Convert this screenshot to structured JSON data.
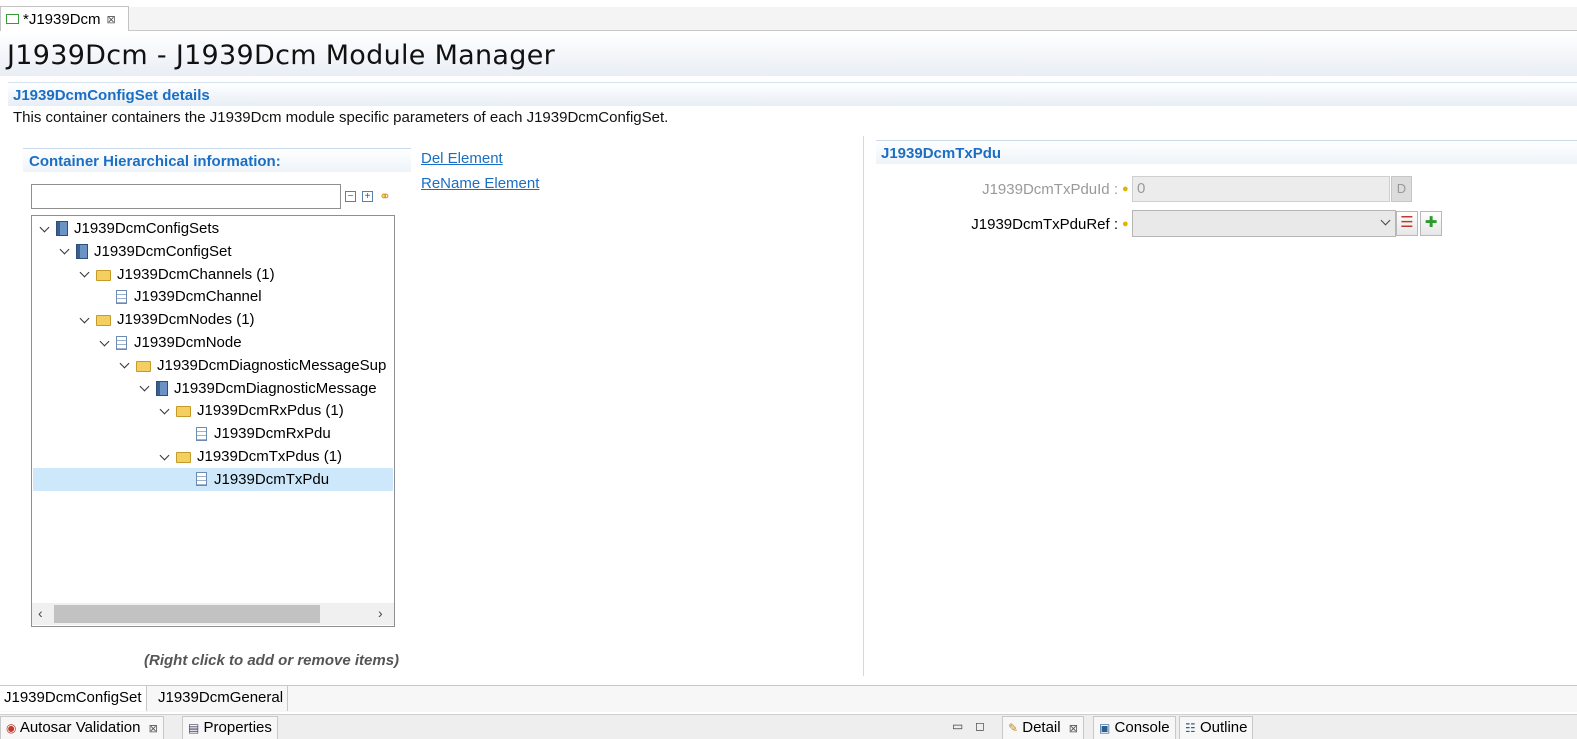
{
  "editor_tab": {
    "label": "*J1939Dcm",
    "close": "⊠"
  },
  "title": "J1939Dcm - J1939Dcm Module Manager",
  "section": {
    "title": "J1939DcmConfigSet details",
    "description": "This container containers the J1939Dcm module specific parameters of each J1939DcmConfigSet."
  },
  "hierarchy": {
    "title": "Container Hierarchical information:",
    "filter_value": "",
    "collapse_all": "−",
    "expand_all": "+",
    "link_icon": "⚭",
    "tree": [
      {
        "label": "J1939DcmConfigSets",
        "level": 0,
        "icon": "book-icon",
        "expanded": true
      },
      {
        "label": "J1939DcmConfigSet",
        "level": 1,
        "icon": "book-icon",
        "expanded": true
      },
      {
        "label": "J1939DcmChannels (1)",
        "level": 2,
        "icon": "folder-icon",
        "expanded": true
      },
      {
        "label": "J1939DcmChannel",
        "level": 3,
        "icon": "document-icon",
        "expanded": null
      },
      {
        "label": "J1939DcmNodes (1)",
        "level": 2,
        "icon": "folder-icon",
        "expanded": true
      },
      {
        "label": "J1939DcmNode",
        "level": 3,
        "icon": "document-icon",
        "expanded": true
      },
      {
        "label": "J1939DcmDiagnosticMessageSup",
        "level": 4,
        "icon": "folder-icon",
        "expanded": true
      },
      {
        "label": "J1939DcmDiagnosticMessage",
        "level": 5,
        "icon": "book-icon",
        "expanded": true
      },
      {
        "label": "J1939DcmRxPdus (1)",
        "level": 6,
        "icon": "folder-icon",
        "expanded": true
      },
      {
        "label": "J1939DcmRxPdu",
        "level": 7,
        "icon": "document-icon",
        "expanded": null
      },
      {
        "label": "J1939DcmTxPdus (1)",
        "level": 6,
        "icon": "folder-icon",
        "expanded": true
      },
      {
        "label": "J1939DcmTxPdu",
        "level": 7,
        "icon": "document-icon",
        "expanded": null,
        "selected": true
      }
    ],
    "hint": "(Right click to add or remove items)"
  },
  "actions": {
    "delete": "Del Element",
    "rename": "ReName Element"
  },
  "detail": {
    "title": "J1939DcmTxPdu",
    "pdu_id_label": "J1939DcmTxPduId :",
    "pdu_id_value": "0",
    "default_button": "D",
    "pdu_ref_label": "J1939DcmTxPduRef :",
    "pdu_ref_value": "",
    "list_button": "☰",
    "add_button": "✚"
  },
  "page_tabs": [
    "J1939DcmConfigSet",
    "J1939DcmGeneral"
  ],
  "views_left": [
    "Autosar Validation",
    "Properties"
  ],
  "views_right": [
    "Detail",
    "Console",
    "Outline"
  ],
  "minimize": "▭",
  "maximize": "◻",
  "colors": {
    "accent": "#1a6fc4",
    "selection": "#cde8fb"
  }
}
